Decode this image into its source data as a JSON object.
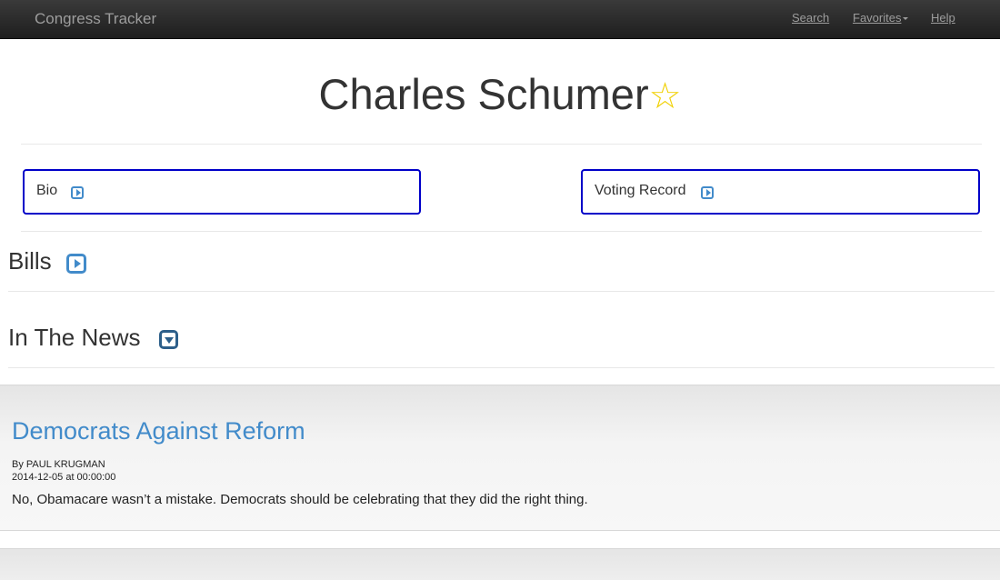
{
  "navbar": {
    "brand": "Congress Tracker",
    "links": [
      {
        "label": "Search"
      },
      {
        "label": "Favorites"
      },
      {
        "label": "Help"
      }
    ]
  },
  "legislator": {
    "name": "Charles Schumer",
    "favorite_icon": "star-outline-icon",
    "favorite_color": "#f0d000"
  },
  "panels": {
    "bio": {
      "label": "Bio"
    },
    "voting": {
      "label": "Voting Record"
    }
  },
  "sections": {
    "bills": {
      "title": "Bills",
      "icon": "expand-right-icon"
    },
    "news": {
      "title": "In The News",
      "icon": "collapse-down-icon"
    }
  },
  "news": [
    {
      "title": "Democrats Against Reform",
      "byline": "By PAUL KRUGMAN",
      "date": "2014-12-05 at 00:00:00",
      "summary": "No, Obamacare wasn’t a mistake. Democrats should be celebrating that they did the right thing."
    }
  ],
  "colors": {
    "accent": "#428bca",
    "panel_border": "#0000c8",
    "navbar": "#222222"
  }
}
